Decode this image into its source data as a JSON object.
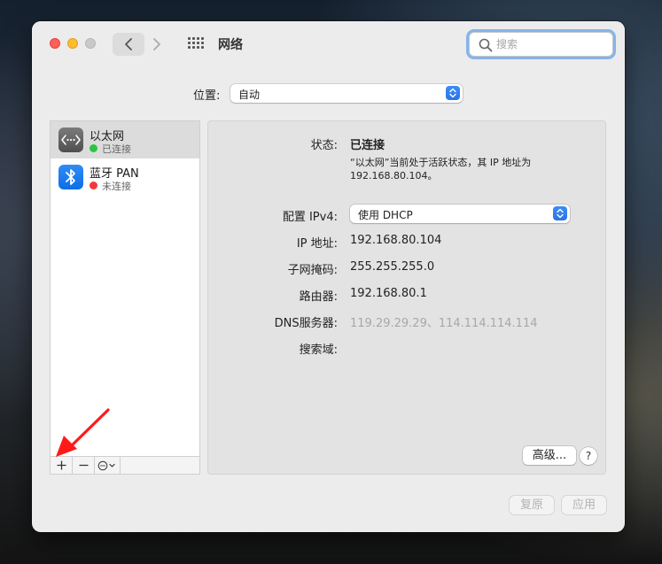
{
  "window": {
    "title": "网络",
    "search_placeholder": "搜索"
  },
  "location": {
    "label": "位置:",
    "value": "自动"
  },
  "services": [
    {
      "name": "以太网",
      "status": "已连接",
      "status_color": "#2ac63e",
      "icon": "ethernet-icon"
    },
    {
      "name": "蓝牙 PAN",
      "status": "未连接",
      "status_color": "#f03a3a",
      "icon": "bluetooth-icon"
    }
  ],
  "list_toolbar": {
    "add": "+",
    "remove": "−"
  },
  "detail": {
    "status_label": "状态:",
    "status_value": "已连接",
    "status_desc": "“以太网”当前处于活跃状态，其 IP 地址为 192.168.80.104。",
    "config_label": "配置 IPv4:",
    "config_value": "使用 DHCP",
    "ip_label": "IP 地址:",
    "ip_value": "192.168.80.104",
    "subnet_label": "子网掩码:",
    "subnet_value": "255.255.255.0",
    "router_label": "路由器:",
    "router_value": "192.168.80.1",
    "dns_label": "DNS服务器:",
    "dns_value": "119.29.29.29、114.114.114.114",
    "search_domain_label": "搜索域:",
    "advanced_button": "高级...",
    "help_button": "?"
  },
  "footer": {
    "revert": "复原",
    "apply": "应用"
  },
  "colors": {
    "accent": "#2a74e6",
    "annotation": "#ff1a1a"
  }
}
